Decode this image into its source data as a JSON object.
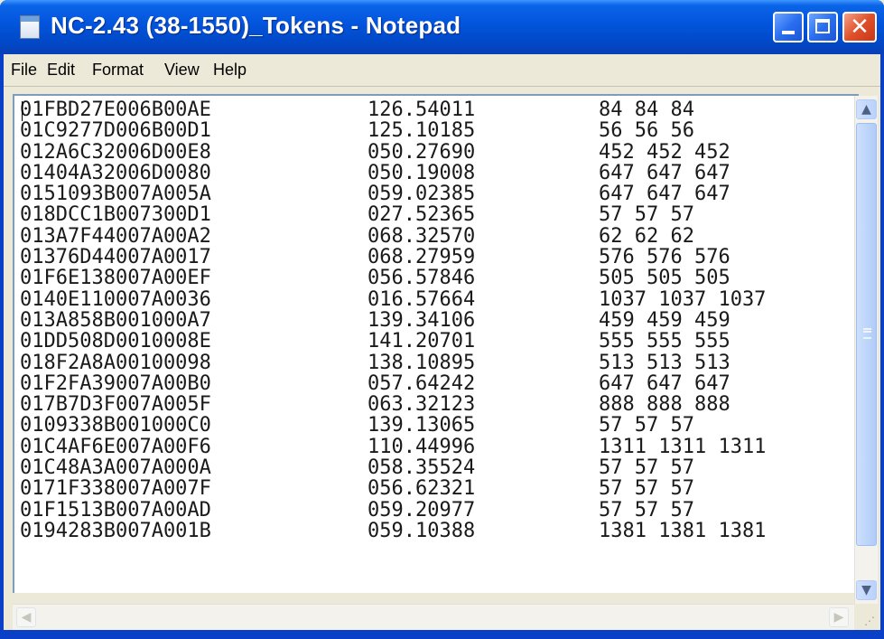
{
  "window": {
    "title": "NC-2.43 (38-1550)_Tokens - Notepad",
    "icon": "notepad-icon",
    "close_glyph": "✕"
  },
  "menu": {
    "items": [
      {
        "label": "File"
      },
      {
        "label": "Edit"
      },
      {
        "label": "Format"
      },
      {
        "label": "View"
      },
      {
        "label": "Help"
      }
    ]
  },
  "document": {
    "lines": [
      {
        "id": "01FBD27E006B00AE",
        "value": "126.54011",
        "counts": "84 84 84"
      },
      {
        "id": "01C9277D006B00D1",
        "value": "125.10185",
        "counts": "56 56 56"
      },
      {
        "id": "012A6C32006D00E8",
        "value": "050.27690",
        "counts": "452 452 452"
      },
      {
        "id": "01404A32006D0080",
        "value": "050.19008",
        "counts": "647 647 647"
      },
      {
        "id": "0151093B007A005A",
        "value": "059.02385",
        "counts": "647 647 647"
      },
      {
        "id": "018DCC1B007300D1",
        "value": "027.52365",
        "counts": "57 57 57"
      },
      {
        "id": "013A7F44007A00A2",
        "value": "068.32570",
        "counts": "62 62 62"
      },
      {
        "id": "01376D44007A0017",
        "value": "068.27959",
        "counts": "576 576 576"
      },
      {
        "id": "01F6E138007A00EF",
        "value": "056.57846",
        "counts": "505 505 505"
      },
      {
        "id": "0140E110007A0036",
        "value": "016.57664",
        "counts": "1037 1037 1037"
      },
      {
        "id": "013A858B001000A7",
        "value": "139.34106",
        "counts": "459 459 459"
      },
      {
        "id": "01DD508D0010008E",
        "value": "141.20701",
        "counts": "555 555 555"
      },
      {
        "id": "018F2A8A00100098",
        "value": "138.10895",
        "counts": "513 513 513"
      },
      {
        "id": "01F2FA39007A00B0",
        "value": "057.64242",
        "counts": "647 647 647"
      },
      {
        "id": "017B7D3F007A005F",
        "value": "063.32123",
        "counts": "888 888 888"
      },
      {
        "id": "0109338B001000C0",
        "value": "139.13065",
        "counts": "57 57 57"
      },
      {
        "id": "01C4AF6E007A00F6",
        "value": "110.44996",
        "counts": "1311 1311 1311"
      },
      {
        "id": "01C48A3A007A000A",
        "value": "058.35524",
        "counts": "57 57 57"
      },
      {
        "id": "0171F338007A007F",
        "value": "056.62321",
        "counts": "57 57 57"
      },
      {
        "id": "01F1513B007A00AD",
        "value": "059.20977",
        "counts": "57 57 57"
      },
      {
        "id": "0194283B007A001B",
        "value": "059.10388",
        "counts": "1381 1381 1381"
      }
    ]
  },
  "scrollbars": {
    "up_glyph": "▲",
    "down_glyph": "▼",
    "left_glyph": "◀",
    "right_glyph": "▶",
    "grip_glyph": "⋰"
  }
}
